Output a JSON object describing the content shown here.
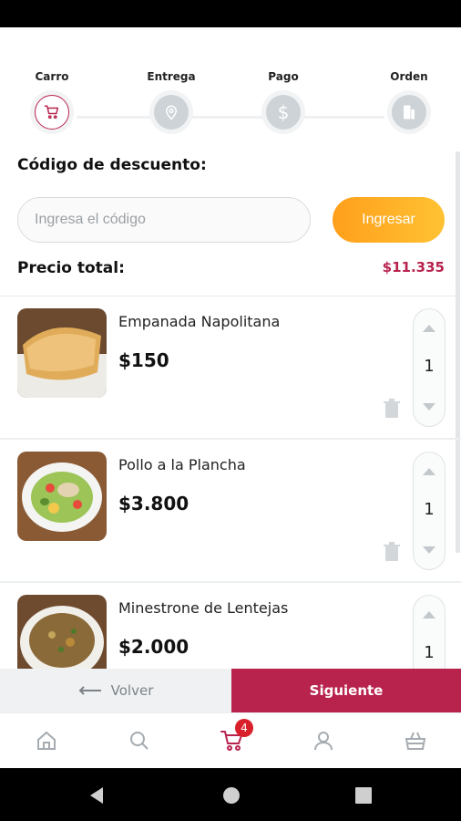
{
  "steps": [
    {
      "label": "Carro",
      "icon": "cart-icon",
      "active": true
    },
    {
      "label": "Entrega",
      "icon": "location-pin-icon",
      "active": false
    },
    {
      "label": "Pago",
      "icon": "dollar-icon",
      "active": false
    },
    {
      "label": "Orden",
      "icon": "order-icon",
      "active": false
    }
  ],
  "discount": {
    "title": "Código de descuento:",
    "placeholder": "Ingresa el código",
    "value": "",
    "apply_label": "Ingresar"
  },
  "total": {
    "label": "Precio total:",
    "value": "$11.335"
  },
  "items": [
    {
      "name": "Empanada Napolitana",
      "price": "$150",
      "qty": "1",
      "image": "empanada-photo"
    },
    {
      "name": "Pollo a la Plancha",
      "price": "$3.800",
      "qty": "1",
      "image": "salad-photo"
    },
    {
      "name": "Minestrone de Lentejas",
      "price": "$2.000",
      "qty": "1",
      "image": "stew-photo"
    }
  ],
  "footer": {
    "back_label": "Volver",
    "next_label": "Siguiente"
  },
  "tabbar": {
    "items": [
      "home-icon",
      "search-icon",
      "cart-icon",
      "user-icon",
      "basket-icon"
    ],
    "cart_badge": "4"
  },
  "colors": {
    "accent": "#b8234e",
    "orange": "#ffb020",
    "inactive": "#cdd3d6"
  }
}
